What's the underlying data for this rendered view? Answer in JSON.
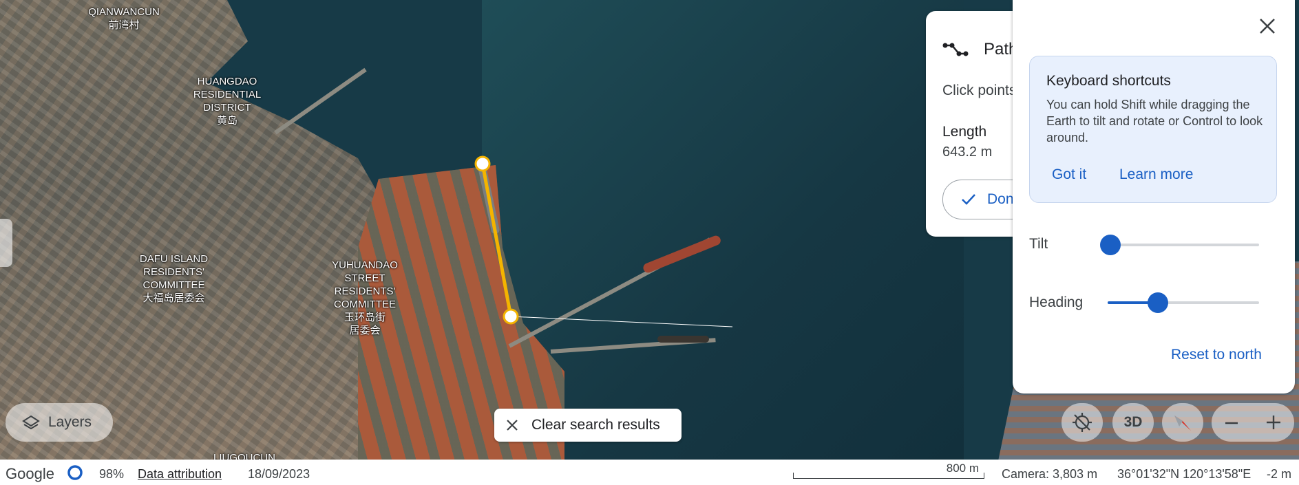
{
  "map": {
    "labels": [
      {
        "id": "qianwancun",
        "text": "QIANWANCUN\n前湾村"
      },
      {
        "id": "huangdao",
        "text": "HUANGDAO\nRESIDENTIAL\nDISTRICT\n黄岛"
      },
      {
        "id": "dafu",
        "text": "DAFU ISLAND\nRESIDENTS'\nCOMMITTEE\n大福岛居委会"
      },
      {
        "id": "yuhuandao",
        "text": "YUHUANDAO\nSTREET\nRESIDENTS'\nCOMMITTEE\n玉环岛街\n居委会"
      },
      {
        "id": "liugoucun",
        "text": "LIUGOUCUN"
      }
    ],
    "path_color": "#f4b400"
  },
  "path_panel": {
    "title": "Path",
    "hint": "Click points",
    "length_label": "Length",
    "length_value": "643.2 m",
    "done_label": "Done"
  },
  "controls": {
    "tip_title": "Keyboard shortcuts",
    "tip_body": "You can hold Shift while dragging the Earth to tilt and rotate or Control to look around.",
    "got_it": "Got it",
    "learn_more": "Learn more",
    "tilt_label": "Tilt",
    "tilt_value": 0,
    "heading_label": "Heading",
    "heading_value": 0.33,
    "reset_label": "Reset to north"
  },
  "toolbar": {
    "layers_label": "Layers",
    "clear_label": "Clear search results",
    "three_d_label": "3D"
  },
  "status": {
    "brand": "Google",
    "progress": "98%",
    "attribution": "Data attribution",
    "date": "18/09/2023",
    "scale": "800 m",
    "camera": "Camera: 3,803 m",
    "coords": "36°01'32\"N 120°13'58\"E",
    "elevation": "-2 m"
  },
  "colors": {
    "accent": "#1a5fc4",
    "compass_red": "#d93025"
  }
}
